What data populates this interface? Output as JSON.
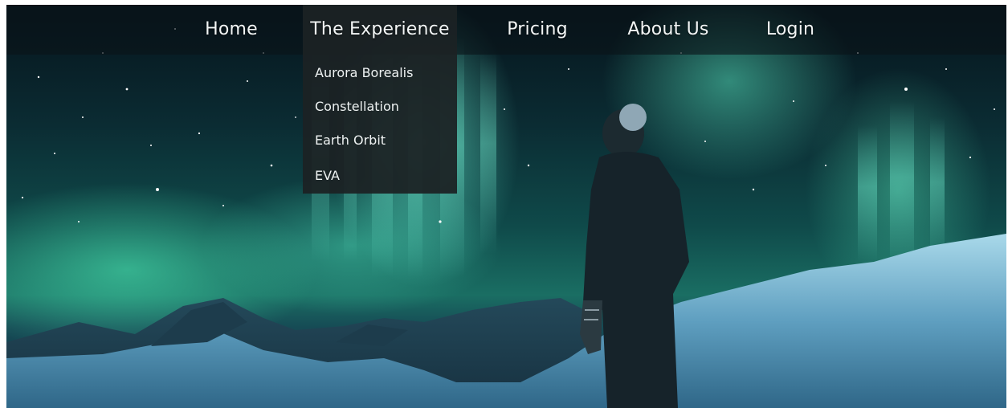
{
  "nav": {
    "items": [
      {
        "label": "Home"
      },
      {
        "label": "The Experience",
        "active": true
      },
      {
        "label": "Pricing"
      },
      {
        "label": "About Us"
      },
      {
        "label": "Login"
      }
    ],
    "dropdown": {
      "items": [
        {
          "label": "Aurora Borealis"
        },
        {
          "label": "Constellation"
        },
        {
          "label": "Earth Orbit"
        },
        {
          "label": "EVA"
        }
      ]
    }
  },
  "hero": {
    "image": "aurora-borealis-night-sky-with-person-on-snowy-mountain"
  },
  "colors": {
    "aurora": "#6ff5cf",
    "snow": "#9fd2e6",
    "navbar_bg": "#141c1f",
    "dropdown_bg": "#1c2224"
  }
}
